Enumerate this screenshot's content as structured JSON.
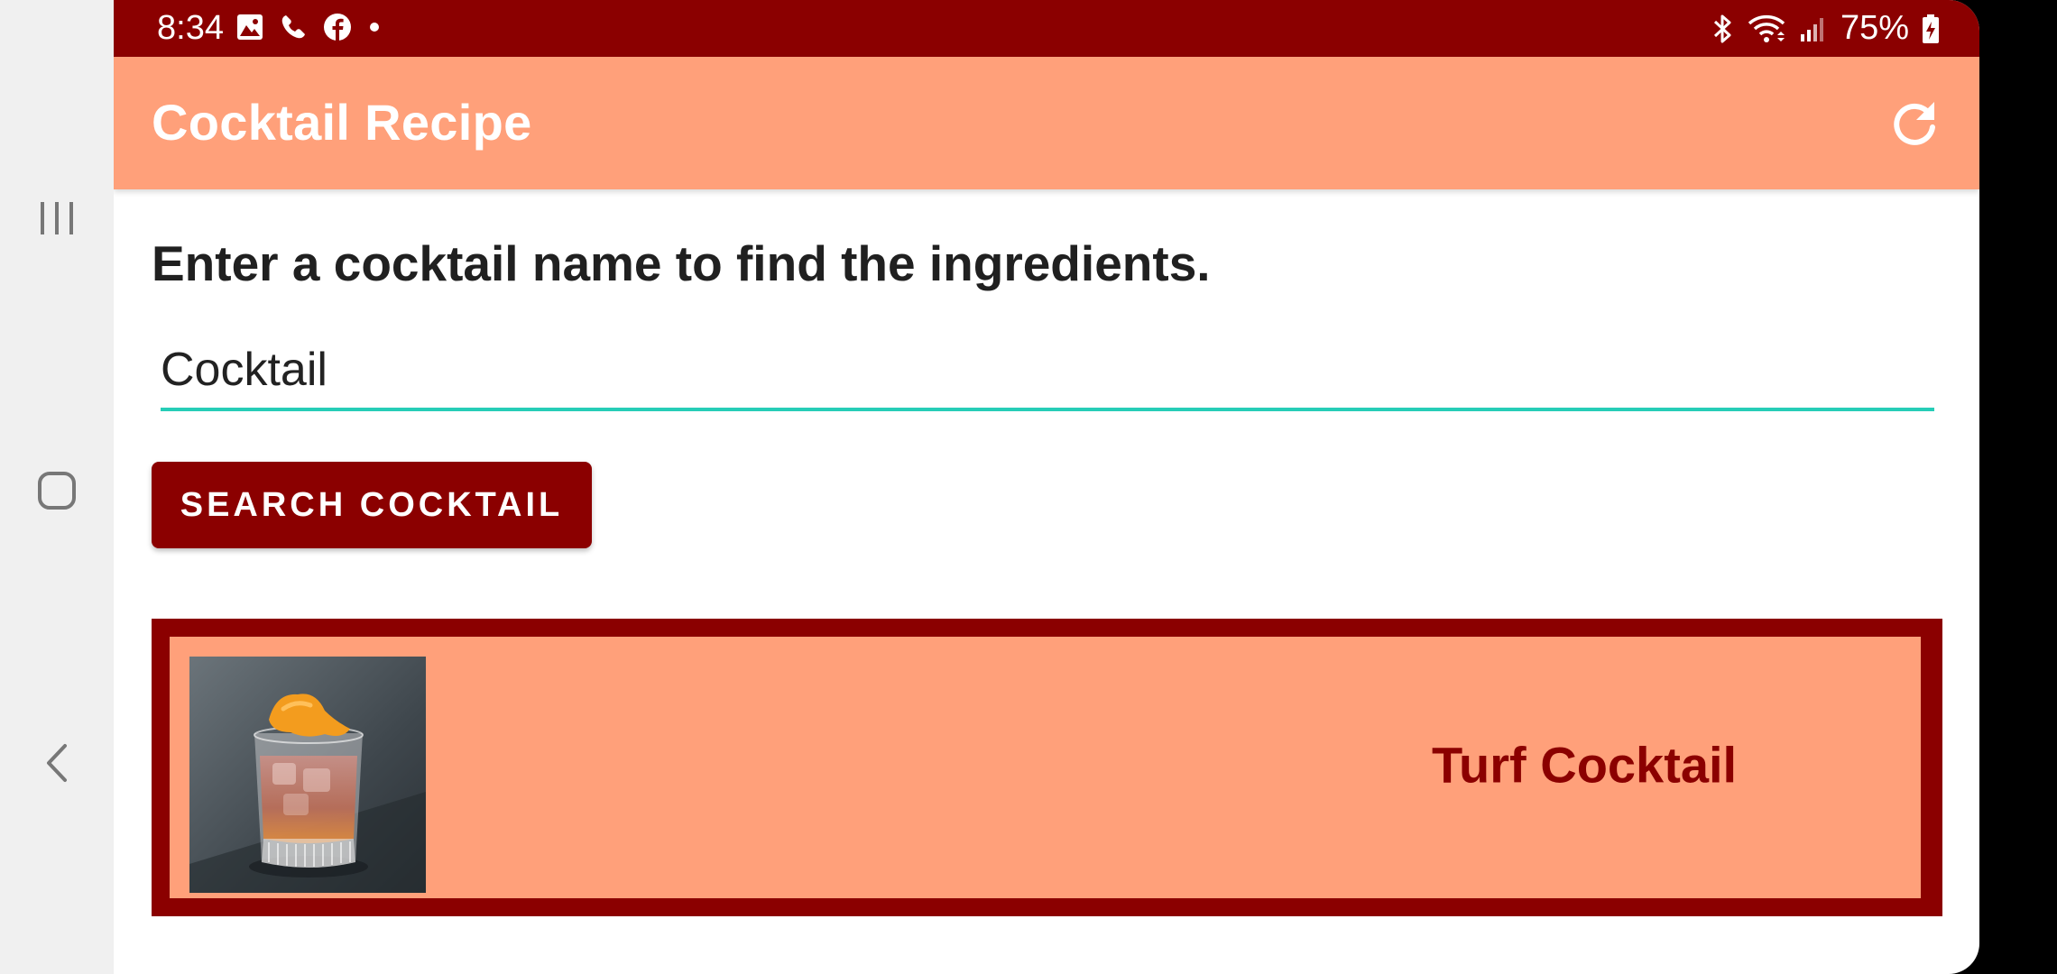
{
  "status_bar": {
    "time": "8:34",
    "battery_percent": "75%",
    "left_icons": [
      "image-icon",
      "phone-icon",
      "facebook-icon",
      "dot-icon"
    ],
    "right_icons": [
      "bluetooth-icon",
      "wifi-icon",
      "signal-icon",
      "battery-charging-icon"
    ]
  },
  "app_bar": {
    "title": "Cocktail Recipe",
    "action_icon": "refresh-icon"
  },
  "main": {
    "instruction": "Enter a cocktail name to find the ingredients.",
    "search_value": "Cocktail",
    "search_button_label": "SEARCH COCKTAIL"
  },
  "results": [
    {
      "name": "Turf Cocktail",
      "image": "cocktail-glass-orange-peel"
    }
  ],
  "nav_bar": {
    "buttons": [
      "recents-icon",
      "home-icon",
      "back-icon"
    ]
  },
  "colors": {
    "primary_dark": "#8b0000",
    "primary": "#ffa07a",
    "accent": "#26cdb7"
  }
}
